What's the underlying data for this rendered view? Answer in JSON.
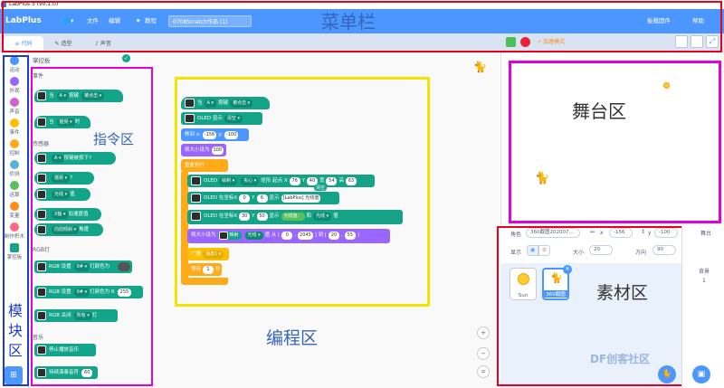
{
  "titlebar": {
    "title": "LabPlus 3 (v0.1.0)"
  },
  "menubar": {
    "logo": "LabPlus",
    "items": [
      "文件",
      "编辑"
    ],
    "tutorial": "教程",
    "project_name": "0708Scratch作品 (1)",
    "right_items": [
      "板载固件",
      "帮助"
    ],
    "annotation": "菜单栏"
  },
  "tabs": [
    "代码",
    "造型",
    "声音"
  ],
  "run": {
    "turbo": "加速模式"
  },
  "categories": [
    "运动",
    "外观",
    "声音",
    "事件",
    "控制",
    "侦测",
    "运算",
    "变量",
    "制作积木",
    "掌控板"
  ],
  "category_colors": [
    "#4c97ff",
    "#9966ff",
    "#cf63cf",
    "#ffbf00",
    "#ffab19",
    "#5cb1d6",
    "#59c059",
    "#ff8c1a",
    "#ff6680",
    "#12a58a"
  ],
  "module_label": [
    "模",
    "块",
    "区"
  ],
  "palette": {
    "title": "掌控板",
    "sections": [
      "事件",
      "传感器",
      "RGB灯",
      "音乐"
    ],
    "annotation": "指令区",
    "blocks": [
      {
        "text": "当",
        "pill1": "A ▾",
        "text2": "按键",
        "pill2": "被点击 ▾"
      },
      {
        "text": "当",
        "pill1": "摇晃 ▾",
        "text2": "时"
      },
      {
        "text": "",
        "pill1": "A ▾",
        "text2": "按键被按下?"
      },
      {
        "text": "",
        "pill1": "摇晃 ▾",
        "text2": "?"
      },
      {
        "text": "",
        "pill1": "光线 ▾",
        "text2": "值"
      },
      {
        "text": "",
        "pill1": "X轴 ▾",
        "text2": "加速度值"
      },
      {
        "text": "",
        "pill1": "向前倾斜 ▾",
        "text2": "角度"
      },
      {
        "text": "RGB 设置",
        "pill1": "0# ▾",
        "text2": "灯颜色为"
      },
      {
        "text": "RGB 设置",
        "pill1": "0# ▾",
        "text2": "灯颜色为 R",
        "val": "255"
      },
      {
        "text": "RGB 关闭",
        "pill1": "所有 ▾",
        "text2": "灯"
      },
      {
        "text": "停止播放音乐",
        "pill1": "",
        "text2": ""
      },
      {
        "text": "持续演奏音符",
        "pill1": "",
        "text2": "",
        "val": "60"
      }
    ]
  },
  "coding": {
    "annotation": "编程区",
    "blocks": {
      "hat": {
        "t1": "当",
        "p1": "A ▾",
        "t2": "按键",
        "p2": "被点击 ▾"
      },
      "oled_clear": {
        "t1": "OLED 显示",
        "p1": "清空 ▾"
      },
      "move": {
        "t1": "移到 x:",
        "v1": "-156",
        "t2": "y:",
        "v2": "-100"
      },
      "size": {
        "t1": "将大小设为",
        "v1": "100"
      },
      "forever": {
        "t1": "重复执行"
      },
      "draw_rect": {
        "t1": "OLED",
        "p1": "绘制 ▾",
        "p2": "实心 ▾",
        "t2": "矩形 起点 X",
        "v1": "76",
        "t3": "Y",
        "v2": "40",
        "t4": "宽",
        "v3": "54",
        "t5": "高",
        "v4": "63"
      },
      "show_text1": {
        "t1": "OLED 在坐标X",
        "v1": "0",
        "t2": "Y",
        "v2": "6",
        "t3": "显示",
        "v3": "[LabPlus] 光线值",
        "t4": "清空"
      },
      "show_text2": {
        "t1": "OLED 在坐标X",
        "v1": "30",
        "t2": "Y",
        "v2": "50",
        "t3": "显示",
        "p1": "光线值：",
        "t4": "和",
        "p2": "光线 ▾",
        "t5": "值"
      },
      "map": {
        "t1": "将大小设为",
        "t2": "映射",
        "p1": "光线 ▾",
        "t3": "值 从 [",
        "v1": "0",
        "t4": ",",
        "v2": "2045",
        "t5": "] 到 [",
        "v3": "20",
        "t6": ",",
        "v4": "55",
        "t7": "]"
      },
      "oled_show": {
        "t1": "广播",
        "p1": "消息1 ▾"
      },
      "wait": {
        "t1": "等待",
        "v1": "1",
        "t2": "秒"
      }
    },
    "zoom": [
      "+",
      "−",
      "="
    ]
  },
  "stage": {
    "annotation": "舞台区"
  },
  "sprite_info": {
    "role_label": "角色",
    "role_value": "360截图202007...",
    "x_label": "x",
    "x_value": "-156",
    "y_label": "y",
    "y_value": "-100",
    "show_label": "显示",
    "size_label": "大小",
    "size_value": "20",
    "dir_label": "方向",
    "dir_value": "90"
  },
  "sprites": {
    "annotation": "素材区",
    "items": [
      "Sun",
      "360截图"
    ]
  },
  "stage_panel": {
    "label": "舞台",
    "bg_label": "背景",
    "bg_count": "1"
  },
  "watermark": "DF创客社区"
}
